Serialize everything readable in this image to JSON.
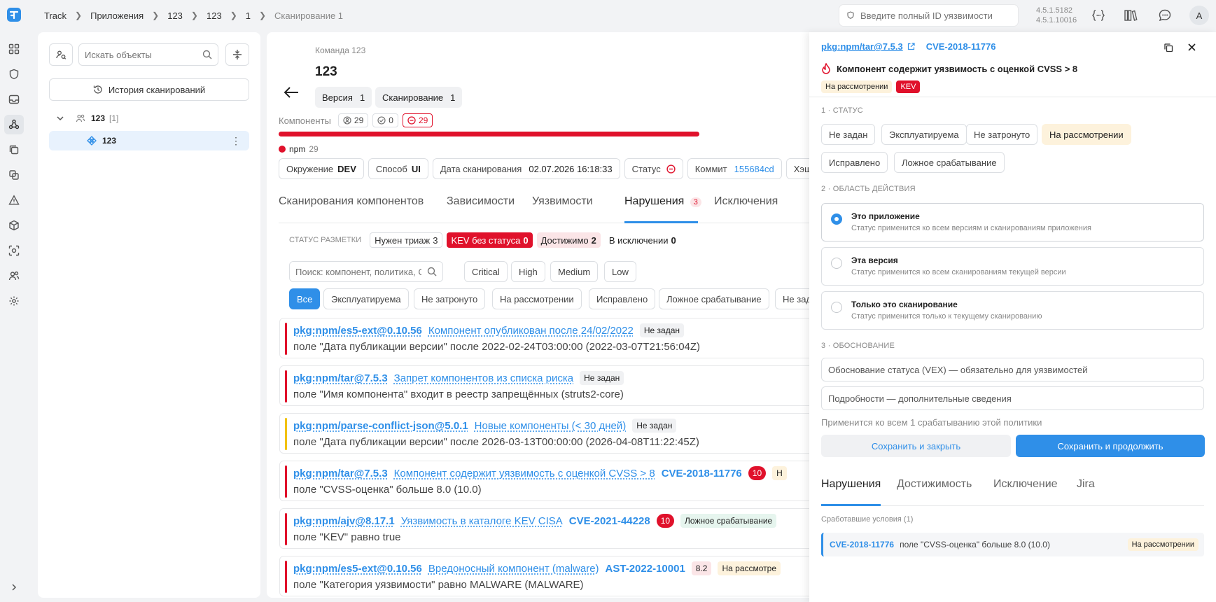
{
  "breadcrumb": [
    "Track",
    "Приложения",
    "123",
    "123",
    "1",
    "Сканирование 1"
  ],
  "topbar": {
    "search_placeholder": "Введите полный ID уязвимости",
    "versions": [
      "4.5.1.5182",
      "4.5.1.10016"
    ],
    "avatar": "A"
  },
  "objects": {
    "search_placeholder": "Искать объекты",
    "history_label": "История сканирований",
    "tree": [
      {
        "name": "123",
        "count": "[1]"
      },
      {
        "name": "123"
      }
    ]
  },
  "scan": {
    "team": "Команда 123",
    "title": "123",
    "version_label": "Версия",
    "version_value": "1",
    "scan_label": "Сканирование",
    "scan_value": "1",
    "components_label": "Компоненты",
    "comp_counts": [
      "29",
      "0",
      "29"
    ],
    "ecosystem": "npm",
    "ecosystem_count": "29",
    "meta": [
      {
        "label": "Окружение",
        "value": "DEV"
      },
      {
        "label": "Способ",
        "value": "UI"
      },
      {
        "label": "Дата сканирования",
        "value": "02.07.2026 16:18:33"
      },
      {
        "label": "Статус",
        "value": ""
      },
      {
        "label": "Коммит",
        "value": "155684cd"
      },
      {
        "label": "Хэш к",
        "value": ""
      }
    ]
  },
  "tabs": {
    "items": [
      "Сканирования компонентов",
      "Зависимости",
      "Уязвимости",
      "Нарушения",
      "Исключения"
    ],
    "violations_count": "3"
  },
  "markup": {
    "label": "СТАТУС РАЗМЕТКИ",
    "chips": [
      {
        "label": "Нужен триаж",
        "count": "3"
      },
      {
        "label": "KEV без статуса",
        "count": "0"
      },
      {
        "label": "Достижимо",
        "count": "2"
      },
      {
        "label": "В исключении",
        "count": "0"
      }
    ]
  },
  "filters": {
    "search_placeholder": "Поиск: компонент, политика, CVE",
    "severities": [
      "Critical",
      "High",
      "Medium",
      "Low"
    ],
    "statuses": [
      "Все",
      "Эксплуатируема",
      "Не затронуто",
      "На рассмотрении",
      "Исправлено",
      "Ложное срабатывание",
      "Не зад"
    ]
  },
  "violations": [
    {
      "pkg": "pkg:npm/es5-ext@0.10.56",
      "policy": "Компонент опубликован после 24/02/2022",
      "status": "Не задан",
      "cond": "поле \"Дата публикации версии\" после 2022-02-24T03:00:00 (2022-03-07T21:56:04Z)",
      "color": "#e0112b"
    },
    {
      "pkg": "pkg:npm/tar@7.5.3",
      "policy": "Запрет компонентов из списка риска",
      "status": "Не задан",
      "cond": "поле \"Имя компонента\" входит в реестр запрещённых (struts2-core)",
      "color": "#e0112b"
    },
    {
      "pkg": "pkg:npm/parse-conflict-json@5.0.1",
      "policy": "Новые компоненты (< 30 дней)",
      "status": "Не задан",
      "cond": "поле \"Дата публикации версии\" после 2026-03-13T00:00:00 (2026-04-08T11:22:45Z)",
      "color": "#f2c200"
    },
    {
      "pkg": "pkg:npm/tar@7.5.3",
      "policy": "Компонент содержит уязвимость с оценкой CVSS > 8",
      "cve": "CVE-2018-11776",
      "score": "10",
      "status": "Н",
      "cond": "поле \"CVSS-оценка\" больше 8.0 (10.0)",
      "color": "#e0112b"
    },
    {
      "pkg": "pkg:npm/ajv@8.17.1",
      "policy": "Уязвимость в каталоге KEV CISA",
      "cve": "CVE-2021-44228",
      "score": "10",
      "status": "Ложное срабатывание",
      "cond": "поле \"KEV\" равно true",
      "color": "#e0112b"
    },
    {
      "pkg": "pkg:npm/es5-ext@0.10.56",
      "policy": "Вредоносный компонент (malware)",
      "cve": "AST-2022-10001",
      "score": "8.2",
      "status": "На рассмотре",
      "cond": "поле \"Категория уязвимости\" равно MALWARE (MALWARE)",
      "color": "#e0112b"
    }
  ],
  "panel": {
    "pkg": "pkg:npm/tar@7.5.3",
    "cve": "CVE-2018-11776",
    "title": "Компонент содержит уязвимость с оценкой CVSS > 8",
    "status_badge": "На рассмотрении",
    "kev_badge": "KEV",
    "step1": "1 · СТАТУС",
    "statuses": [
      "Не задан",
      "Эксплуатируема",
      "Не затронуто",
      "На рассмотрении",
      "Исправлено",
      "Ложное срабатывание"
    ],
    "step2": "2 · ОБЛАСТЬ ДЕЙСТВИЯ",
    "scopes": [
      {
        "title": "Это приложение",
        "desc": "Статус применится ко всем версиям и сканированиям приложения"
      },
      {
        "title": "Эта версия",
        "desc": "Статус применится ко всем сканированиям текущей версии"
      },
      {
        "title": "Только это сканирование",
        "desc": "Статус применится только к текущему сканированию"
      }
    ],
    "step3": "3 · ОБОСНОВАНИЕ",
    "justification_placeholder": "Обоснование статуса (VEX) — обязательно для уязвимостей",
    "details_placeholder": "Подробности — дополнительные сведения",
    "applies_note": "Применится ко всем 1 срабатыванию этой политики",
    "save_close": "Сохранить и закрыть",
    "save_continue": "Сохранить и продолжить",
    "tabs": [
      "Нарушения",
      "Достижимость",
      "Исключение",
      "Jira"
    ],
    "triggered_label": "Сработавшие условия (1)",
    "triggered": {
      "cve": "CVE-2018-11776",
      "cond": "поле \"CVSS-оценка\" больше 8.0 (10.0)",
      "status": "На рассмотрении"
    }
  },
  "colors": {
    "accent": "#2f8fe8",
    "danger": "#e0112b",
    "warning": "#f2c200",
    "review": "#fdf2dc"
  }
}
